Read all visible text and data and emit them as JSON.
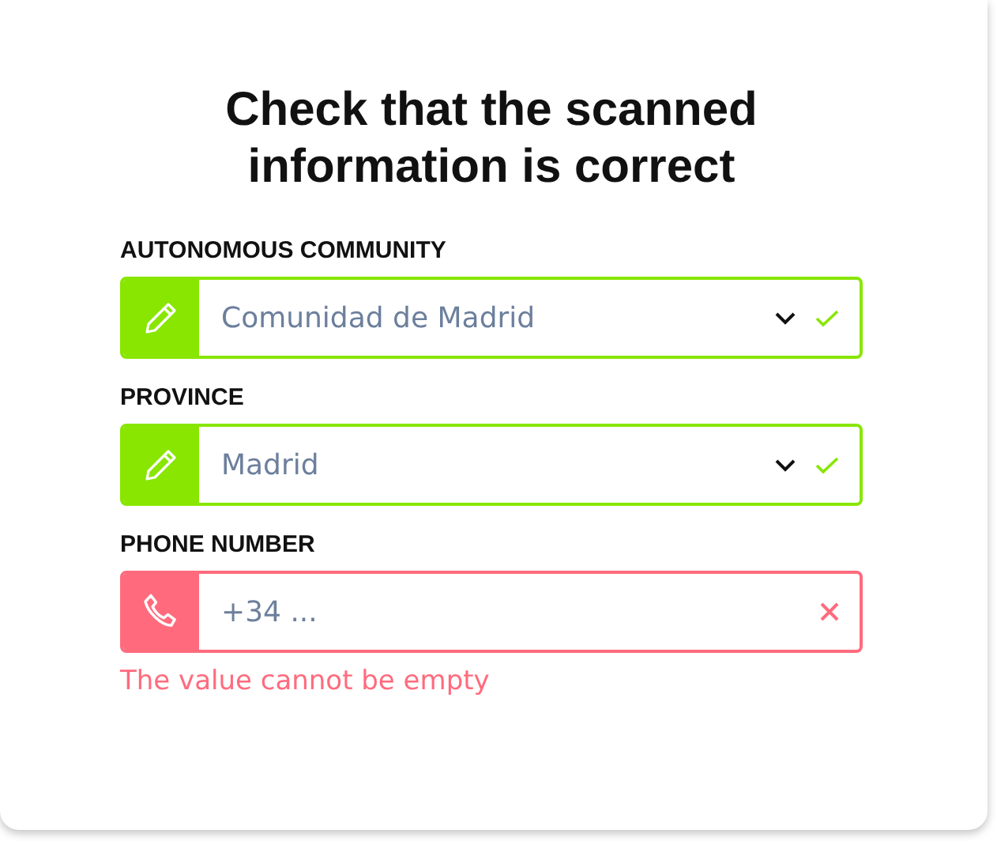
{
  "title": "Check that the scanned information is correct",
  "fields": [
    {
      "label": "AUTONOMOUS COMMUNITY",
      "kind": "select",
      "value": "Comunidad de Madrid",
      "valid": true
    },
    {
      "label": "PROVINCE",
      "kind": "select",
      "value": "Madrid",
      "valid": true
    },
    {
      "label": "PHONE NUMBER",
      "kind": "text",
      "placeholder": "+34 ...",
      "valid": false,
      "error": "The value cannot be empty"
    }
  ]
}
